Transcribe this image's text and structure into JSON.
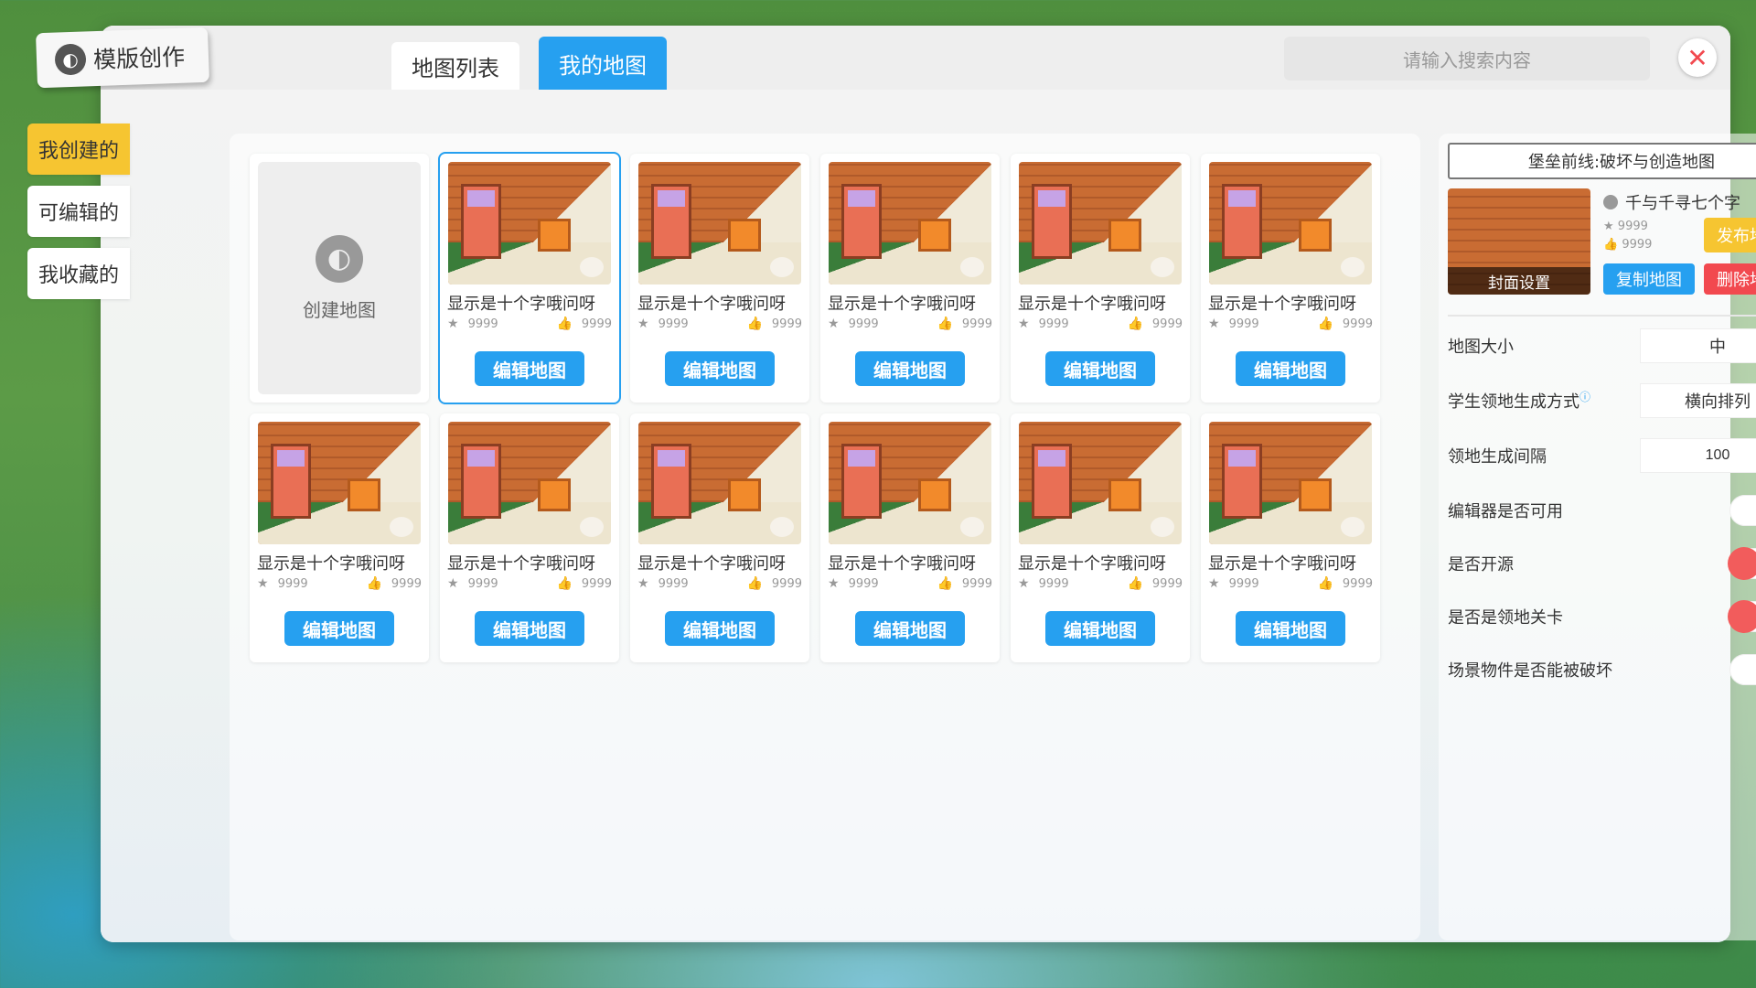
{
  "app": {
    "title": "模版创作"
  },
  "header": {
    "tabs": [
      {
        "label": "地图列表",
        "active": false
      },
      {
        "label": "我的地图",
        "active": true
      }
    ],
    "search_placeholder": "请输入搜索内容",
    "close_label": "✕"
  },
  "sidebar": {
    "items": [
      {
        "label": "我创建的",
        "active": true
      },
      {
        "label": "可编辑的",
        "active": false
      },
      {
        "label": "我收藏的",
        "active": false
      }
    ]
  },
  "create_card": {
    "label": "创建地图"
  },
  "cards": [
    {
      "title": "显示是十个字哦问呀",
      "stars": "9999",
      "likes": "9999",
      "button": "编辑地图"
    },
    {
      "title": "显示是十个字哦问呀",
      "stars": "9999",
      "likes": "9999",
      "button": "编辑地图"
    },
    {
      "title": "显示是十个字哦问呀",
      "stars": "9999",
      "likes": "9999",
      "button": "编辑地图"
    },
    {
      "title": "显示是十个字哦问呀",
      "stars": "9999",
      "likes": "9999",
      "button": "编辑地图"
    },
    {
      "title": "显示是十个字哦问呀",
      "stars": "9999",
      "likes": "9999",
      "button": "编辑地图"
    },
    {
      "title": "显示是十个字哦问呀",
      "stars": "9999",
      "likes": "9999",
      "button": "编辑地图"
    },
    {
      "title": "显示是十个字哦问呀",
      "stars": "9999",
      "likes": "9999",
      "button": "编辑地图"
    },
    {
      "title": "显示是十个字哦问呀",
      "stars": "9999",
      "likes": "9999",
      "button": "编辑地图"
    },
    {
      "title": "显示是十个字哦问呀",
      "stars": "9999",
      "likes": "9999",
      "button": "编辑地图"
    },
    {
      "title": "显示是十个字哦问呀",
      "stars": "9999",
      "likes": "9999",
      "button": "编辑地图"
    },
    {
      "title": "显示是十个字哦问呀",
      "stars": "9999",
      "likes": "9999",
      "button": "编辑地图"
    }
  ],
  "detail": {
    "map_name": "堡垒前线:破坏与创造地图",
    "cover_label": "封面设置",
    "author": "千与千寻七个字",
    "stars": "9999",
    "likes": "9999",
    "publish_label": "发布地图",
    "copy_label": "复制地图",
    "delete_label": "删除地图",
    "settings": {
      "map_size": {
        "label": "地图大小",
        "value": "中"
      },
      "territory_mode": {
        "label": "学生领地生成方式",
        "value": "横向排列"
      },
      "territory_gap": {
        "label": "领地生成间隔",
        "value": "100"
      },
      "editor_available": {
        "label": "编辑器是否可用",
        "on": true
      },
      "open_source": {
        "label": "是否开源",
        "on": false
      },
      "territory_level": {
        "label": "是否是领地关卡",
        "on": false
      },
      "destructible": {
        "label": "场景物件是否能被破坏",
        "on": true
      }
    }
  },
  "colors": {
    "accent": "#26a0f0",
    "yellow": "#f6c531",
    "red": "#f2494f",
    "green": "#21c97f"
  }
}
